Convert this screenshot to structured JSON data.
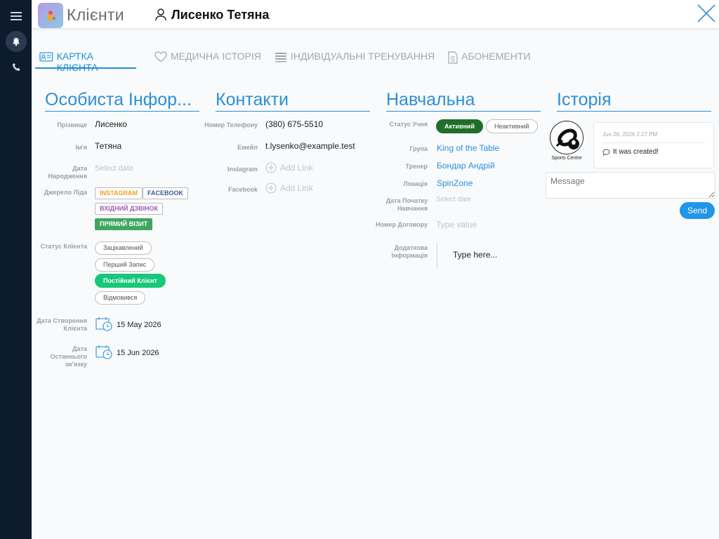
{
  "header": {
    "app_title": "Клієнти",
    "client_name": "Лисенко Тетяна"
  },
  "tabs": [
    {
      "label": "КАРТКА КЛІЄНТА",
      "icon": "id-card-icon",
      "active": true
    },
    {
      "label": "МЕДИЧНА ІСТОРІЯ",
      "icon": "heart-icon",
      "active": false
    },
    {
      "label": "ІНДИВІДУАЛЬНІ ТРЕНУВАННЯ",
      "icon": "list-icon",
      "active": false
    },
    {
      "label": "АБОНЕМЕНТИ",
      "icon": "document-icon",
      "active": false
    }
  ],
  "personal": {
    "title": "Особиста Інфор...",
    "surname_label": "Прізвище",
    "surname": "Лисенко",
    "name_label": "Ім'я",
    "name": "Тетяна",
    "birth_label": "Дата Народження",
    "birth_placeholder": "Select date",
    "lead_label": "Джерело Ліда",
    "lead_tags": [
      {
        "label": "INSTAGRAM",
        "color": "#f0a020",
        "active": false
      },
      {
        "label": "FACEBOOK",
        "color": "#3b5998",
        "active": false
      },
      {
        "label": "ВХІДНИЙ ДЗВІНОК",
        "color": "#9b59b6",
        "active": false
      },
      {
        "label": "ПРЯМИЙ ВІЗИТ",
        "color": "#27a95a",
        "active": true
      }
    ],
    "status_label": "Статус Клієнта",
    "statuses": [
      {
        "label": "Зацікавлений",
        "active": false
      },
      {
        "label": "Перший Запис",
        "active": false
      },
      {
        "label": "Постійний Клієнт",
        "active": true
      },
      {
        "label": "Відмовився",
        "active": false
      }
    ],
    "created_label": "Дата Створення Клієнта",
    "created": "15 May 2026",
    "last_contact_label": "Дата Останнього зв'язку",
    "last_contact": "15 Jun 2026"
  },
  "contacts": {
    "title": "Контакти",
    "phone_label": "Номер Телефону",
    "phone": "(380) 675-5510",
    "email_label": "Емейл",
    "email": "t.lysenko@example.test",
    "instagram_label": "Instagram",
    "facebook_label": "Facebook",
    "add_link": "Add Link"
  },
  "study": {
    "title": "Навчальна",
    "status_label": "Статус Учня",
    "active_label": "Активний",
    "inactive_label": "Неактивний",
    "group_label": "Група",
    "group": "King of the Table",
    "trainer_label": "Тренер",
    "trainer": "Бондар Андрій",
    "location_label": "Локація",
    "location": "SpinZone",
    "start_label": "Дата Початку Навчання",
    "start_placeholder": "Select date",
    "contract_label": "Номер Договору",
    "contract_placeholder": "Type value",
    "extra_label": "Додаткова Інформація",
    "extra_placeholder": "Type here..."
  },
  "history": {
    "title": "Історія",
    "avatar_caption": "Sports Centre",
    "entry_date": "Jun 26, 2026 2:27 PM",
    "entry_text": "It was created!",
    "message_placeholder": "Message",
    "send_label": "Send"
  },
  "colors": {
    "accent": "#2d8fd7",
    "active_status": "#1f6e2a",
    "client_status": "#18c77a",
    "sidebar": "#0d1b2e"
  }
}
